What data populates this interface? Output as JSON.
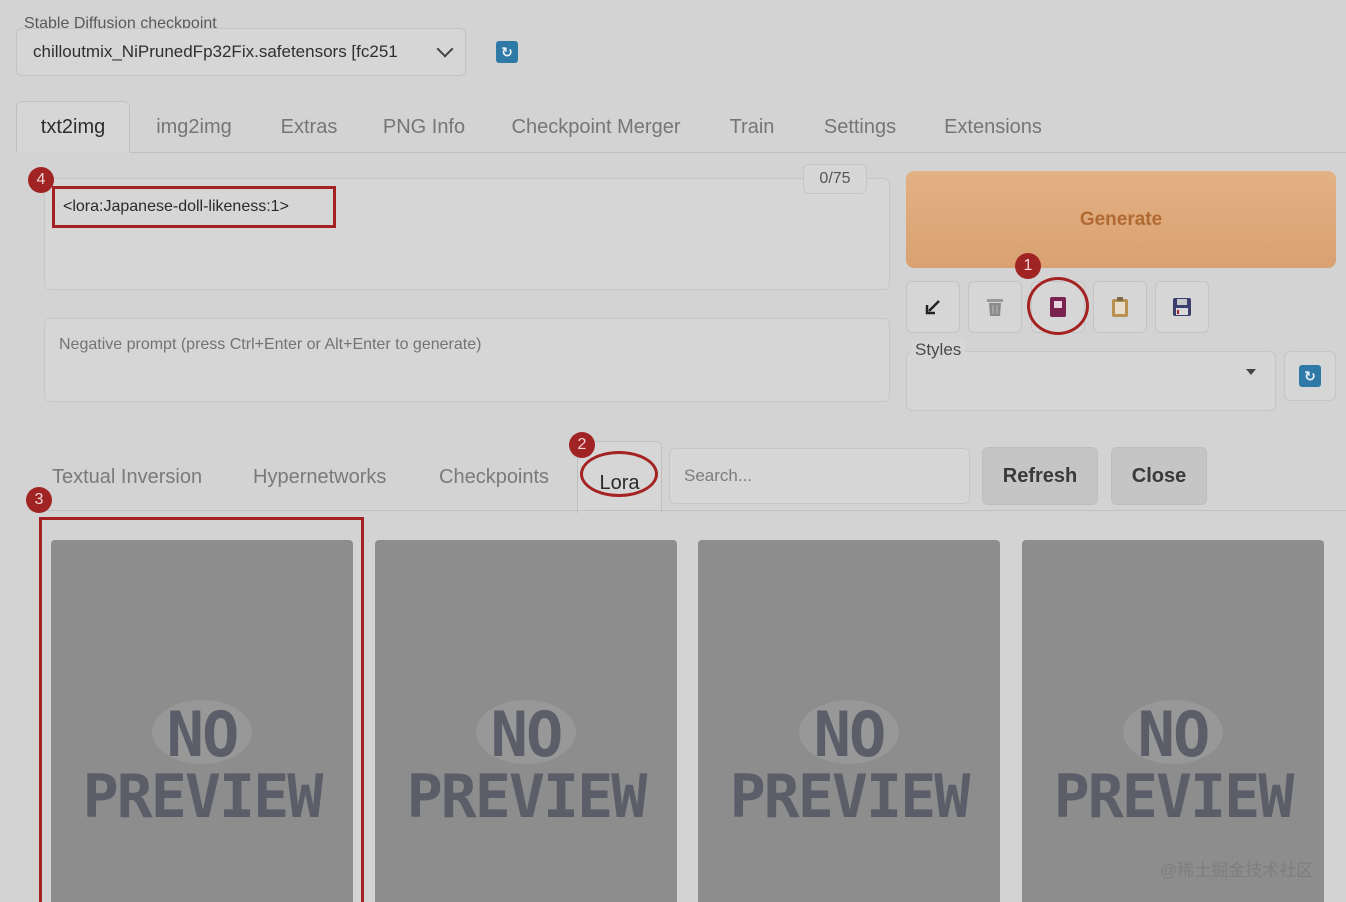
{
  "checkpoint": {
    "label": "Stable Diffusion checkpoint",
    "value": "chilloutmix_NiPrunedFp32Fix.safetensors [fc251"
  },
  "tabs": [
    {
      "label": "txt2img",
      "active": true
    },
    {
      "label": "img2img"
    },
    {
      "label": "Extras"
    },
    {
      "label": "PNG Info"
    },
    {
      "label": "Checkpoint Merger"
    },
    {
      "label": "Train"
    },
    {
      "label": "Settings"
    },
    {
      "label": "Extensions"
    }
  ],
  "prompt": {
    "value": "<lora:Japanese-doll-likeness:1>",
    "token_count": "0/75"
  },
  "negative_prompt": {
    "placeholder": "Negative prompt (press Ctrl+Enter or Alt+Enter to generate)"
  },
  "generate": {
    "label": "Generate"
  },
  "tools": [
    {
      "icon": "arrow-down-left-icon"
    },
    {
      "icon": "trash-icon"
    },
    {
      "icon": "extra-networks-icon"
    },
    {
      "icon": "clipboard-icon"
    },
    {
      "icon": "floppy-save-icon"
    }
  ],
  "styles": {
    "label": "Styles",
    "value": ""
  },
  "extra_networks": {
    "tabs": [
      {
        "label": "Textual Inversion"
      },
      {
        "label": "Hypernetworks"
      },
      {
        "label": "Checkpoints"
      },
      {
        "label": "Lora",
        "active": true
      }
    ],
    "search_placeholder": "Search...",
    "refresh_label": "Refresh",
    "close_label": "Close",
    "cards": [
      {
        "line1": "NO",
        "line2": "PREVIEW"
      },
      {
        "line1": "NO",
        "line2": "PREVIEW"
      },
      {
        "line1": "NO",
        "line2": "PREVIEW"
      },
      {
        "line1": "NO",
        "line2": "PREVIEW"
      }
    ]
  },
  "annotations": [
    "1",
    "2",
    "3",
    "4"
  ],
  "watermark": "@稀土掘金技术社区",
  "colors": {
    "annotation_red": "#a52222",
    "generate_orange": "#d9a171",
    "refresh_blue": "#2f79a6"
  }
}
